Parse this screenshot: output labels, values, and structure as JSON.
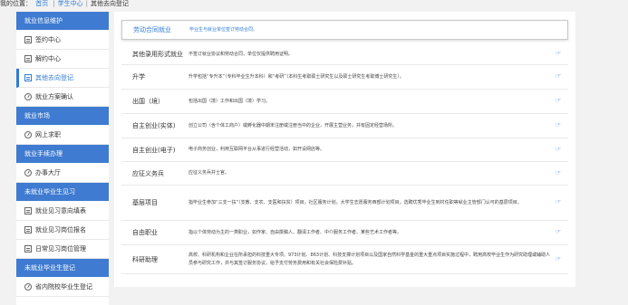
{
  "breadcrumb": {
    "label": "我的位置：",
    "home": "首页",
    "student_center": "学生中心",
    "current": "其他去向登记"
  },
  "sidebar": {
    "sections": [
      {
        "title": "就业信息维护",
        "items": [
          {
            "label": "签约中心",
            "icon": "document-icon"
          },
          {
            "label": "解约中心",
            "icon": "document-icon"
          },
          {
            "label": "其他去向登记",
            "icon": "document-icon",
            "active": true
          },
          {
            "label": "就业方案确认",
            "icon": "compass-icon"
          }
        ]
      },
      {
        "title": "就业市场",
        "items": [
          {
            "label": "网上求职",
            "icon": "compass-icon"
          }
        ]
      },
      {
        "title": "就业手续办理",
        "items": [
          {
            "label": "办事大厅",
            "icon": "compass-icon"
          }
        ]
      },
      {
        "title": "未就业毕业生见习",
        "items": [
          {
            "label": "就业见习意向填表",
            "icon": "document-icon"
          },
          {
            "label": "就业见习岗位报名",
            "icon": "document-icon"
          },
          {
            "label": "日常见习岗位管理",
            "icon": "document-icon"
          }
        ]
      },
      {
        "title": "未就业毕业生登记",
        "items": [
          {
            "label": "省内院校毕业生登记",
            "icon": "compass-icon"
          }
        ]
      }
    ]
  },
  "options": [
    {
      "title": "劳动合同就业",
      "desc": "毕业生与就业单位签订劳动合同。"
    },
    {
      "title": "其他录用形式就业",
      "desc": "不签订就业协议和劳动合同，单位仅提供聘用证明。"
    },
    {
      "title": "升学",
      "desc": "升学包括“专升本”（专科毕业生升本科）和“考研”（本科生考取硕士研究生以及硕士研究生考取博士研究生）。"
    },
    {
      "title": "出国（境）",
      "desc": "包括出国（境）工作和出国（境）学习。"
    },
    {
      "title": "自主创业(实体)",
      "desc": "创立公司（含个体工商户）或孵化器中期末注册或注册当中的企业，开展主营业务，并有固定经营场所。"
    },
    {
      "title": "自主创业(电子)",
      "desc": "电子商务创业，利用互联网平台从事进行经营活动，如开设网店等。"
    },
    {
      "title": "应征义务兵",
      "desc": "应征义务兵并士官。"
    },
    {
      "title": "基层项目",
      "desc": "指毕业生参加“三支一扶”（支教、支农、支医和扶贫）项目，社区服务计划，大学生志愿服务西部计划项目，选聘优秀毕业生到村任职等就业主管部门认可的基层项目。"
    },
    {
      "title": "自由职业",
      "desc": "指以个体劳动为主的一类职业，如作家、自由撰稿人、翻译工作者、中介服务工作者、某些艺术工作者等。"
    },
    {
      "title": "科研助理",
      "desc": "高校、科研机构和企业在所承担的科技重大专项、973计划、863计划、科技支撑计划项目以及国家自然科学基金的重大重点项目实施过程中，聘用高校毕业生作为研究助理或辅助人员参与研究工作，并与其签订服务协议，给予支付劳务费用和有关社会保险费补贴。"
    }
  ]
}
